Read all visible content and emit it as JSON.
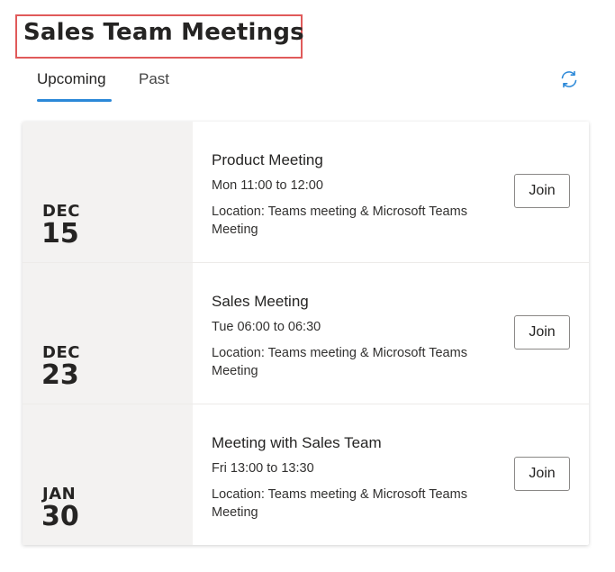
{
  "header": {
    "title": "Sales Team Meetings"
  },
  "tabs": [
    {
      "label": "Upcoming",
      "active": true
    },
    {
      "label": "Past",
      "active": false
    }
  ],
  "refresh_icon": "refresh-icon",
  "accent_color": "#2b88d8",
  "highlight_color": "#e05a5a",
  "meetings": [
    {
      "month": "DEC",
      "day": "15",
      "title": "Product Meeting",
      "time": "Mon 11:00 to 12:00",
      "location": "Location: Teams meeting & Microsoft Teams Meeting",
      "join_label": "Join"
    },
    {
      "month": "DEC",
      "day": "23",
      "title": "Sales Meeting",
      "time": "Tue 06:00 to 06:30",
      "location": "Location: Teams meeting & Microsoft Teams Meeting",
      "join_label": "Join"
    },
    {
      "month": "JAN",
      "day": "30",
      "title": "Meeting with Sales Team",
      "time": "Fri 13:00 to 13:30",
      "location": "Location: Teams meeting & Microsoft Teams Meeting",
      "join_label": "Join"
    }
  ]
}
